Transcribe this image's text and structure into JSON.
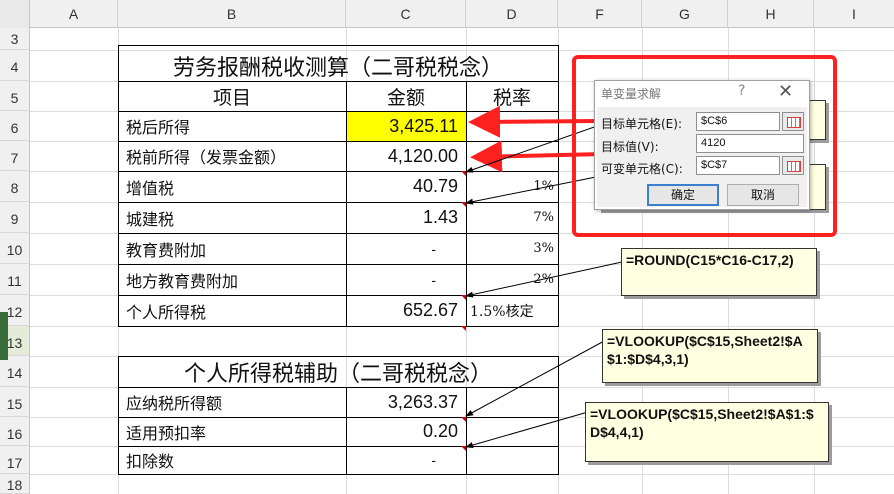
{
  "columns": [
    "A",
    "B",
    "C",
    "D",
    "F",
    "G",
    "H",
    "I"
  ],
  "rows": [
    "3",
    "4",
    "5",
    "6",
    "7",
    "8",
    "9",
    "10",
    "11",
    "12",
    "13",
    "14",
    "15",
    "16",
    "17",
    "18"
  ],
  "table1": {
    "title": "劳务报酬税收测算（二哥税税念）",
    "header": {
      "item": "项目",
      "amount": "金额",
      "rate": "税率"
    },
    "rows": [
      {
        "item": "税后所得",
        "amount": "3,425.11",
        "rate": ""
      },
      {
        "item": "税前所得（发票金额）",
        "amount": "4,120.00",
        "rate": ""
      },
      {
        "item": "增值税",
        "amount": "40.79",
        "rate": "1%"
      },
      {
        "item": "城建税",
        "amount": "1.43",
        "rate": "7%"
      },
      {
        "item": "教育费附加",
        "amount": "-",
        "rate": "3%"
      },
      {
        "item": "地方教育费附加",
        "amount": "-",
        "rate": "2%"
      },
      {
        "item": "个人所得税",
        "amount": "652.67",
        "rate": "1.5%核定"
      }
    ]
  },
  "table2": {
    "title": "个人所得税辅助（二哥税税念）",
    "rows": [
      {
        "item": "应纳税所得额",
        "amount": "3,263.37"
      },
      {
        "item": "适用预扣率",
        "amount": "0.20"
      },
      {
        "item": "扣除数",
        "amount": "-"
      }
    ]
  },
  "comments": {
    "round": "=ROUND(C15*C16-C17,2)",
    "vlookup3_line1": "=VLOOKUP($C$15,Sheet2!$A",
    "vlookup3_line2": "$1:$D$4,3,1)",
    "vlookup4_line1": "=VLOOKUP($C$15,Sheet2!$A$1:$",
    "vlookup4_line2": "D$4,4,1)"
  },
  "dialog": {
    "title": "单变量求解",
    "help": "?",
    "close": "✕",
    "target_cell_label": "目标单元格(E):",
    "target_cell_value": "$C$6",
    "target_value_label": "目标值(V):",
    "target_value_value": "4120",
    "changing_cell_label": "可变单元格(C):",
    "changing_cell_value": "$C$7",
    "ok_label": "确定",
    "cancel_label": "取消"
  },
  "colors": {
    "highlight": "#ffff00",
    "annotation_red": "#ff2020",
    "comment_bg": "#ffffe1"
  }
}
